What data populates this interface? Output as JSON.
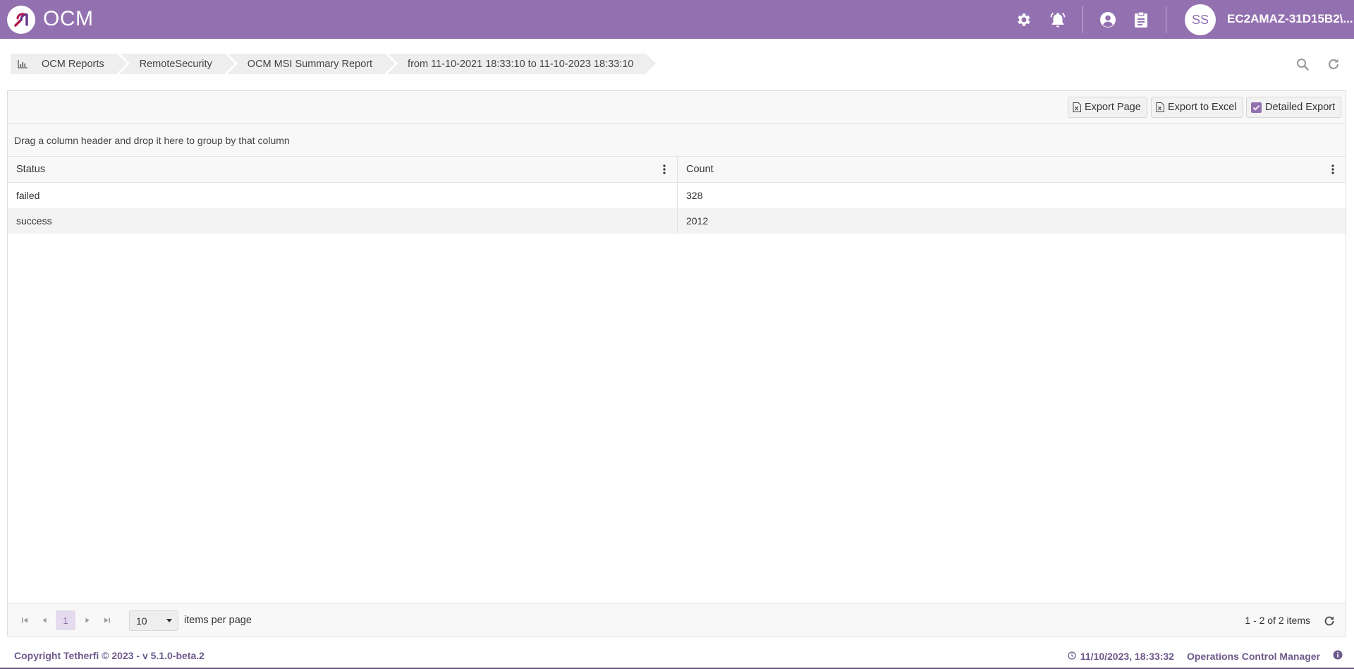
{
  "header": {
    "app_name": "OCM",
    "avatar_initials": "SS",
    "username": "EC2AMAZ-31D15B2\\...",
    "icons": [
      "gear-icon",
      "bell-icon",
      "user-circle-icon",
      "clipboard-icon"
    ]
  },
  "breadcrumb": {
    "items": [
      {
        "label": "OCM Reports",
        "icon": "bar-chart-icon"
      },
      {
        "label": "RemoteSecurity"
      },
      {
        "label": "OCM MSI Summary Report"
      },
      {
        "label": "from 11-10-2021 18:33:10 to 11-10-2023 18:33:10"
      }
    ],
    "tools": [
      "search-icon",
      "refresh-icon"
    ]
  },
  "toolbar": {
    "export_page": "Export Page",
    "export_excel": "Export to Excel",
    "detailed_export": "Detailed Export"
  },
  "grid": {
    "group_hint": "Drag a column header and drop it here to group by that column",
    "columns": [
      "Status",
      "Count"
    ],
    "rows": [
      [
        "failed",
        "328"
      ],
      [
        "success",
        "2012"
      ]
    ]
  },
  "pager": {
    "current_page": "1",
    "page_size": "10",
    "items_per_page_label": "items per page",
    "info": "1 - 2 of 2 items"
  },
  "footer": {
    "copyright": "Copyright Tetherfi © 2023 - v 5.1.0-beta.2",
    "datetime": "11/10/2023, 18:33:32",
    "product": "Operations Control Manager"
  },
  "colors": {
    "brand": "#9370b0",
    "footer_text": "#6e5a8c"
  }
}
